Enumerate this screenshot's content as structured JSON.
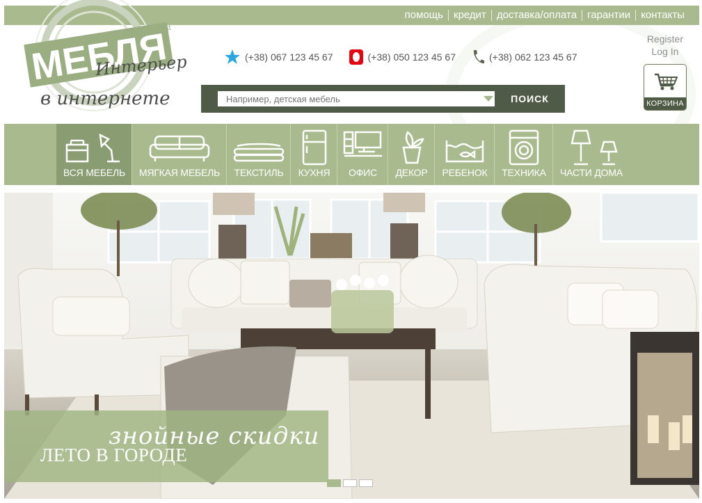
{
  "topnav": [
    "помощь",
    "кредит",
    "доставка/оплата",
    "гарантии",
    "контакты"
  ],
  "logo": {
    "brand": "МЕБЛЯ",
    "tagline_1": "Интерьер",
    "tagline_2": "в интернете",
    "stamp_letters": "st"
  },
  "contacts": [
    {
      "icon": "star-icon",
      "phone": "(+38) 067 123 45 67"
    },
    {
      "icon": "mts-logo-icon",
      "phone": "(+38) 050 123 45 67"
    },
    {
      "icon": "phone-icon",
      "phone": "(+38) 062 123 45 67"
    }
  ],
  "auth": {
    "register": "Register",
    "login": "Log In"
  },
  "cart": {
    "label": "КОРЗИНА"
  },
  "search": {
    "placeholder": "Например, детская мебель",
    "button": "ПОИСК"
  },
  "categories": [
    {
      "label": "ВСЯ МЕБЕЛЬ",
      "icon": "furniture-lamp-icon",
      "active": true
    },
    {
      "label": "МЯГКАЯ МЕБЕЛЬ",
      "icon": "sofa-icon"
    },
    {
      "label": "ТЕКСТИЛЬ",
      "icon": "folded-textile-icon"
    },
    {
      "label": "КУХНЯ",
      "icon": "fridge-icon"
    },
    {
      "label": "ОФИС",
      "icon": "office-desk-icon"
    },
    {
      "label": "ДЕКОР",
      "icon": "plant-pot-icon"
    },
    {
      "label": "РЕБЕНОК",
      "icon": "aquarium-icon"
    },
    {
      "label": "ТЕХНИКА",
      "icon": "washing-machine-icon"
    },
    {
      "label": "ЧАСТИ ДОМА",
      "icon": "lamps-icon"
    }
  ],
  "hero": {
    "script_text": "знойные скидки",
    "title": "ЛЕТО В ГОРОДЕ",
    "slides": 3,
    "active_slide": 1
  },
  "colors": {
    "accent": "#a9bb8e",
    "accent_dark": "#505b47",
    "active_tab": "#899c72"
  }
}
